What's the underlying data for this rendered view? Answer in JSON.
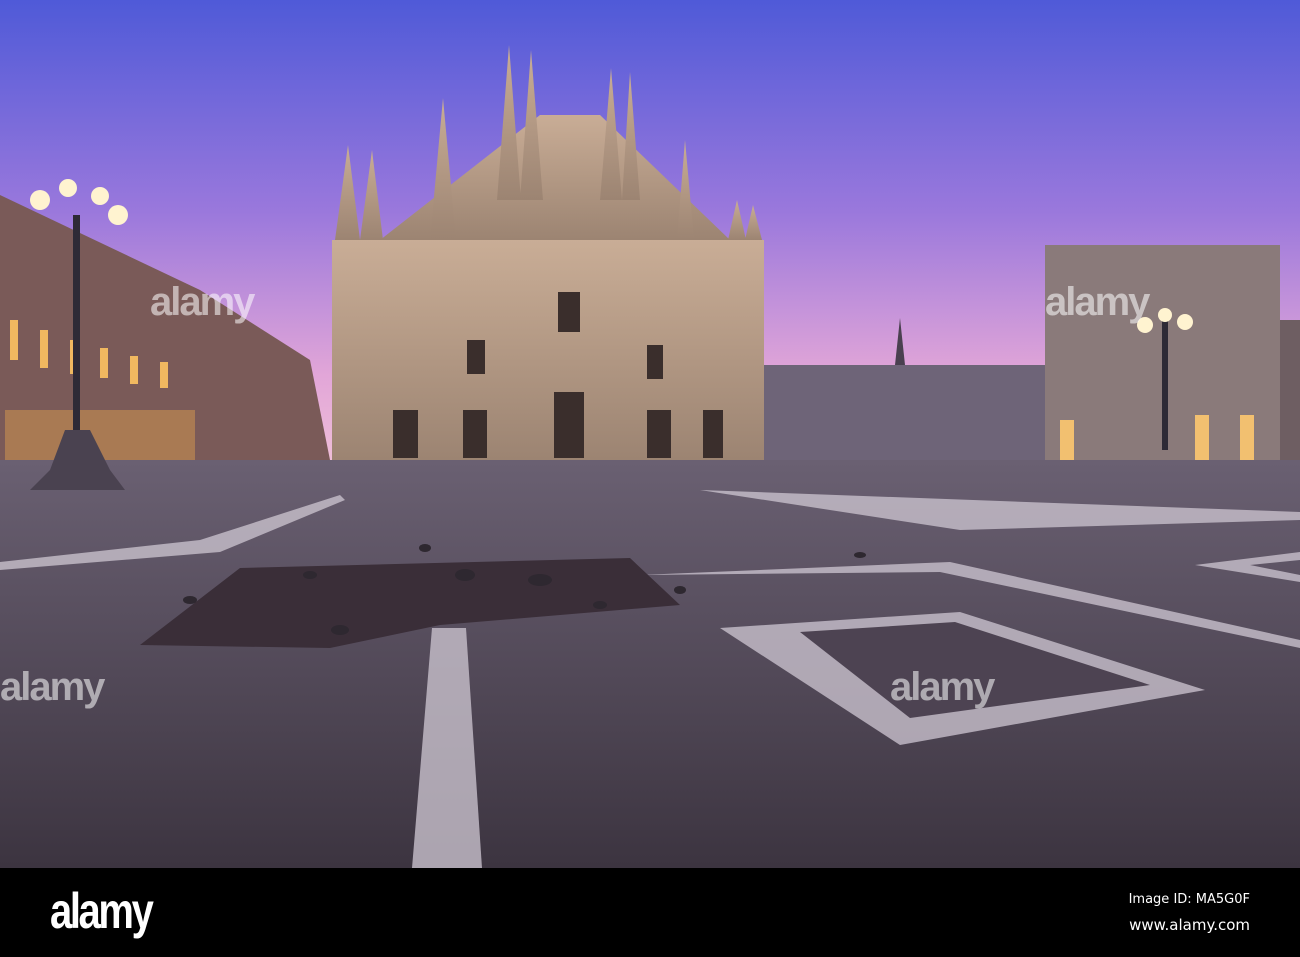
{
  "footer": {
    "logo": "alamy",
    "image_id": "Image ID: MA5G0F",
    "website": "www.alamy.com"
  },
  "watermark": "alamy",
  "colors": {
    "sky_top": "#5a5ad6",
    "sky_horizon": "#e7a6d6",
    "plaza": "#4d4352",
    "cathedral": "#b59a82"
  }
}
